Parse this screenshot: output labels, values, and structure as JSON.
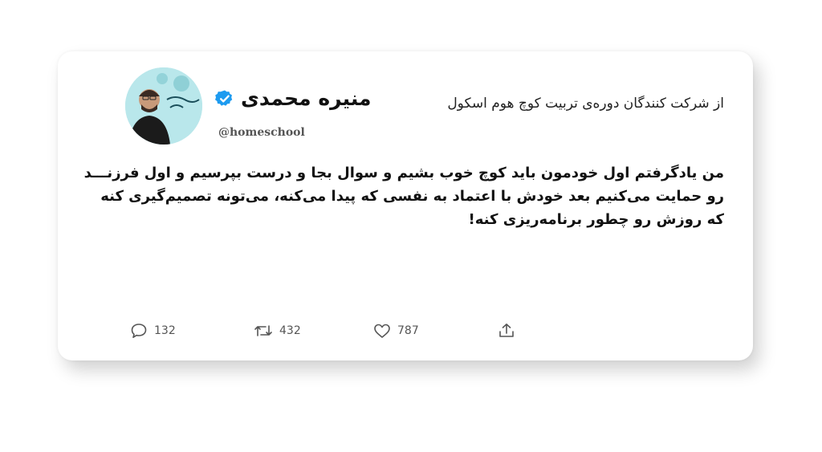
{
  "tweet": {
    "display_name": "منیره محمدی",
    "handle": "@homeschool",
    "subtitle": "از شرکت کنندگان دوره‌ی تربیت کوچ هوم اسکول",
    "avatar_icon": "profile-photo-icon",
    "verified_icon": "verified-badge-icon",
    "accent_color": "#1d9bf0",
    "body_lines": [
      "من یادگرفتم اول خودمون باید کوچ خوب بشیم و سوال بجا و درست بپرسیم و اول فرزنـــد",
      "رو حمایت می‌کنیم بعد خودش با اعتماد به نفسی که پیدا می‌کنه، می‌تونه تصمیم‌گیری کنه",
      "که روزش رو چطور برنامه‌ریزی کنه!"
    ]
  },
  "actions": {
    "reply": {
      "icon": "reply-icon",
      "count": "132"
    },
    "retweet": {
      "icon": "retweet-icon",
      "count": "432"
    },
    "like": {
      "icon": "heart-icon",
      "count": "787"
    },
    "share": {
      "icon": "share-icon"
    }
  }
}
